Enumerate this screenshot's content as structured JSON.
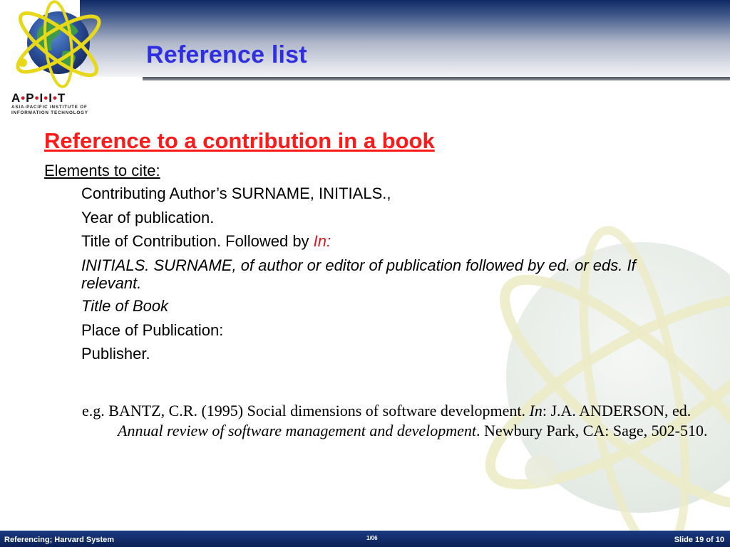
{
  "logo": {
    "brand_letters": [
      "A",
      "P",
      "I",
      "I",
      "T"
    ],
    "subtitle_line1": "ASIA-PACIFIC INSTITUTE OF",
    "subtitle_line2": "INFORMATION TECHNOLOGY"
  },
  "header": {
    "title": "Reference list"
  },
  "content": {
    "section_heading": "Reference to a contribution in a book",
    "subheading": "Elements to cite:",
    "elements": [
      {
        "text": "Contributing Author’s SURNAME, INITIALS.,"
      },
      {
        "text": "Year of publication."
      },
      {
        "text": "Title of Contribution. Followed by ",
        "highlight": "In:"
      },
      {
        "text": "INITIALS. SURNAME, of author or editor of publication followed by ed. or eds. If relevant."
      },
      {
        "text": "Title of Book"
      },
      {
        "text": "Place of Publication:"
      },
      {
        "text": "Publisher."
      }
    ],
    "example": {
      "part1": "e.g. BANTZ, C.R. (1995) Social dimensions of software development. ",
      "in": "In",
      "part2": ": J.A. ANDERSON, ed. ",
      "book_title": "Annual review of software management and development",
      "part3": ". Newbury Park, CA: Sage, 502-510."
    }
  },
  "footer": {
    "left": "Referencing; Harvard System",
    "center": "1/06",
    "right": "Slide 19 of 10"
  },
  "colors": {
    "title": "#2f2fe0",
    "section_heading": "#ff1a1a",
    "highlight": "#e0141a",
    "footer_bg": "#0b1f55"
  }
}
